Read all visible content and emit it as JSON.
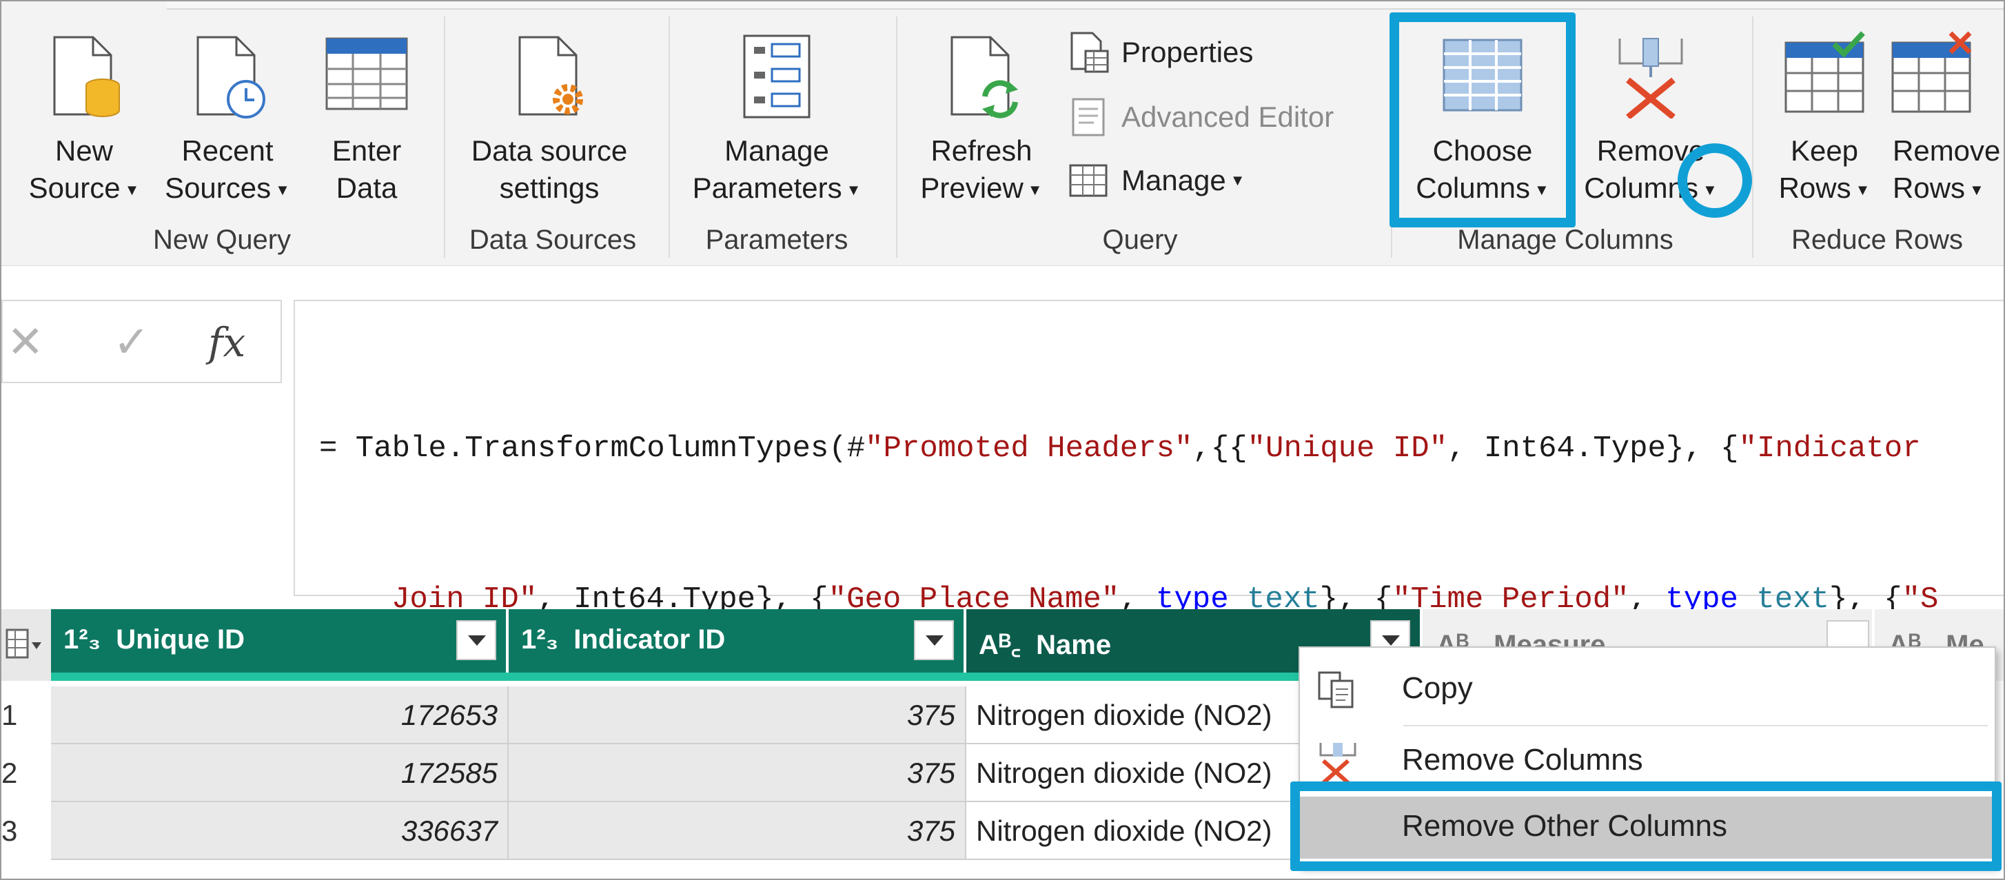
{
  "ribbon": {
    "new_query": {
      "new_source": [
        "New",
        "Source"
      ],
      "recent_sources": [
        "Recent",
        "Sources"
      ],
      "enter_data": [
        "Enter",
        "Data"
      ],
      "group_label": "New Query"
    },
    "data_sources": {
      "settings": [
        "Data source",
        "settings"
      ],
      "group_label": "Data Sources"
    },
    "parameters": {
      "manage": [
        "Manage",
        "Parameters"
      ],
      "group_label": "Parameters"
    },
    "query": {
      "refresh": [
        "Refresh",
        "Preview"
      ],
      "properties": "Properties",
      "advanced_editor": "Advanced Editor",
      "manage": "Manage",
      "group_label": "Query"
    },
    "manage_columns": {
      "choose": [
        "Choose",
        "Columns"
      ],
      "remove": [
        "Remove",
        "Columns"
      ],
      "group_label": "Manage Columns"
    },
    "reduce_rows": {
      "keep": [
        "Keep",
        "Rows"
      ],
      "remove": [
        "Remove",
        "Rows"
      ],
      "group_label": "Reduce Rows"
    }
  },
  "formula_bar": {
    "cancel_icon": "close-icon",
    "commit_icon": "check-icon",
    "fx_label": "fx",
    "line1": [
      {
        "t": "= Table.TransformColumnTypes(#",
        "c": "def"
      },
      {
        "t": "\"Promoted Headers\"",
        "c": "str"
      },
      {
        "t": ",{{",
        "c": "def"
      },
      {
        "t": "\"Unique ID\"",
        "c": "str"
      },
      {
        "t": ", Int64.Type}, {",
        "c": "def"
      },
      {
        "t": "\"Indicator",
        "c": "str"
      }
    ],
    "line2": [
      {
        "t": "Join ID\"",
        "c": "str"
      },
      {
        "t": ", Int64.Type}, {",
        "c": "def"
      },
      {
        "t": "\"Geo Place Name\"",
        "c": "str"
      },
      {
        "t": ", ",
        "c": "def"
      },
      {
        "t": "type",
        "c": "kw"
      },
      {
        "t": " ",
        "c": "def"
      },
      {
        "t": "text",
        "c": "ty"
      },
      {
        "t": "}, {",
        "c": "def"
      },
      {
        "t": "\"Time Period\"",
        "c": "str"
      },
      {
        "t": ", ",
        "c": "def"
      },
      {
        "t": "type",
        "c": "kw"
      },
      {
        "t": " ",
        "c": "def"
      },
      {
        "t": "text",
        "c": "ty"
      },
      {
        "t": "}, {",
        "c": "def"
      },
      {
        "t": "\"S",
        "c": "str"
      }
    ]
  },
  "grid": {
    "columns": [
      {
        "type": "1²₃",
        "name": "Unique ID"
      },
      {
        "type": "1²₃",
        "name": "Indicator ID"
      },
      {
        "type": "Aᴮ꜀",
        "name": "Name"
      },
      {
        "type": "Aᴮ꜀",
        "name": "Measure"
      },
      {
        "type": "Aᴮ꜀",
        "name": "Me"
      }
    ],
    "rows": [
      {
        "n": "1",
        "unique_id": "172653",
        "indicator_id": "375",
        "name": "Nitrogen dioxide (NO2)"
      },
      {
        "n": "2",
        "unique_id": "172585",
        "indicator_id": "375",
        "name": "Nitrogen dioxide (NO2)"
      },
      {
        "n": "3",
        "unique_id": "336637",
        "indicator_id": "375",
        "name": "Nitrogen dioxide (NO2)"
      }
    ]
  },
  "context_menu": {
    "items": [
      "Copy",
      "Remove Columns",
      "Remove Other Columns"
    ],
    "highlighted": "Remove Other Columns"
  },
  "colors": {
    "accent_highlight": "#10a0d6",
    "header_green": "#0d7862",
    "header_selected": "#0c5c4c"
  }
}
